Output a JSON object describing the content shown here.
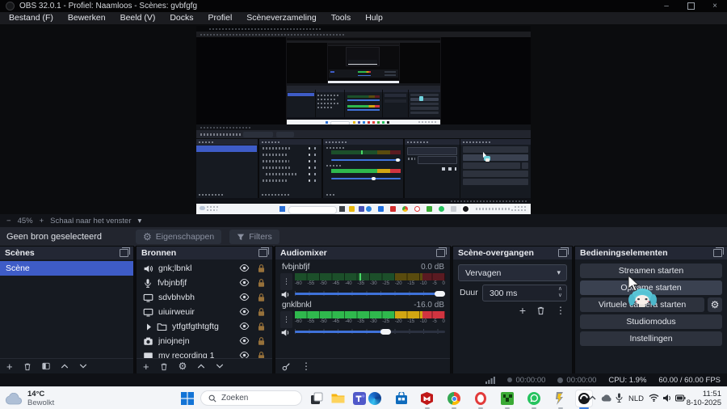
{
  "window": {
    "title": "OBS 32.0.1 - Profiel: Naamloos - Scènes: gvbfgfg",
    "minimize_glyph": "–",
    "close_glyph": "×"
  },
  "menu": {
    "items": [
      "Bestand (F)",
      "Bewerken",
      "Beeld (V)",
      "Docks",
      "Profiel",
      "Scèneverzameling",
      "Tools",
      "Hulp"
    ]
  },
  "zoombar": {
    "minus": "−",
    "zoom": "45%",
    "plus": "+",
    "scale_label": "Schaal naar het venster",
    "caret": "▾"
  },
  "source_toolbar": {
    "message": "Geen bron geselecteerd",
    "properties_label": "Eigenschappen",
    "filters_label": "Filters"
  },
  "scenes": {
    "title": "Scènes",
    "items": [
      {
        "name": "Scène",
        "selected": true
      }
    ]
  },
  "sources": {
    "title": "Bronnen",
    "items": [
      {
        "icon": "speaker",
        "name": "gnk;lbnkl"
      },
      {
        "icon": "microphone",
        "name": "fvbjnbfjf"
      },
      {
        "icon": "display",
        "name": "sdvbhvbh"
      },
      {
        "icon": "display",
        "name": "uiuirweuir"
      },
      {
        "icon": "group-folder",
        "name": "ytfgtfgthtgftg"
      },
      {
        "icon": "camera",
        "name": "jniojnejn"
      },
      {
        "icon": "media",
        "name": "my recording 1"
      }
    ]
  },
  "mixer": {
    "title": "Audiomixer",
    "scale": [
      "-60",
      "-55",
      "-50",
      "-45",
      "-40",
      "-35",
      "-30",
      "-25",
      "-20",
      "-15",
      "-10",
      "-5",
      "0"
    ],
    "channels": [
      {
        "name": "fvbjnbfjf",
        "db": "0.0 dB",
        "slider_pos": 1.0,
        "meter": "dim-with-peak"
      },
      {
        "name": "gnklbnkl",
        "db": "-16.0 dB",
        "slider_pos": 0.61,
        "meter": "full"
      }
    ]
  },
  "transitions": {
    "title": "Scène-overgangen",
    "selected": "Vervagen",
    "duration_label": "Duur",
    "duration_value": "300 ms"
  },
  "controls": {
    "title": "Bedieningselementen",
    "buttons": [
      "Streamen starten",
      "Opname starten",
      "Virtuele camera starten",
      "Studiomodus",
      "Instellingen"
    ]
  },
  "statusbar": {
    "stream_time": "00:00:00",
    "rec_time": "00:00:00",
    "cpu": "CPU: 1.9%",
    "fps": "60.00 / 60.00 FPS"
  },
  "taskbar": {
    "weather_temp": "14°C",
    "weather_condition": "Bewolkt",
    "search_placeholder": "Zoeken",
    "language": "NLD",
    "time": "11:51",
    "date": "8-10-2025",
    "pinned_apps": [
      "task-view",
      "file-explorer",
      "teams",
      "edge",
      "store",
      "mcafee",
      "chrome",
      "opera",
      "minecraft",
      "whatsapp",
      "epic",
      "obs"
    ]
  },
  "icons": {
    "gear": "⚙",
    "dots_vertical": "⋮",
    "plus": "+",
    "caret_down": "▾",
    "chevron_up": "∧",
    "chevron_down": "∨"
  },
  "colors": {
    "accent_blue": "#3e5cc7",
    "meter_green": "#2fb84d",
    "meter_yellow": "#d2a512",
    "meter_red": "#d13440",
    "slider_blue": "#3f72d9",
    "taskbar_active": "#3b7de0"
  }
}
